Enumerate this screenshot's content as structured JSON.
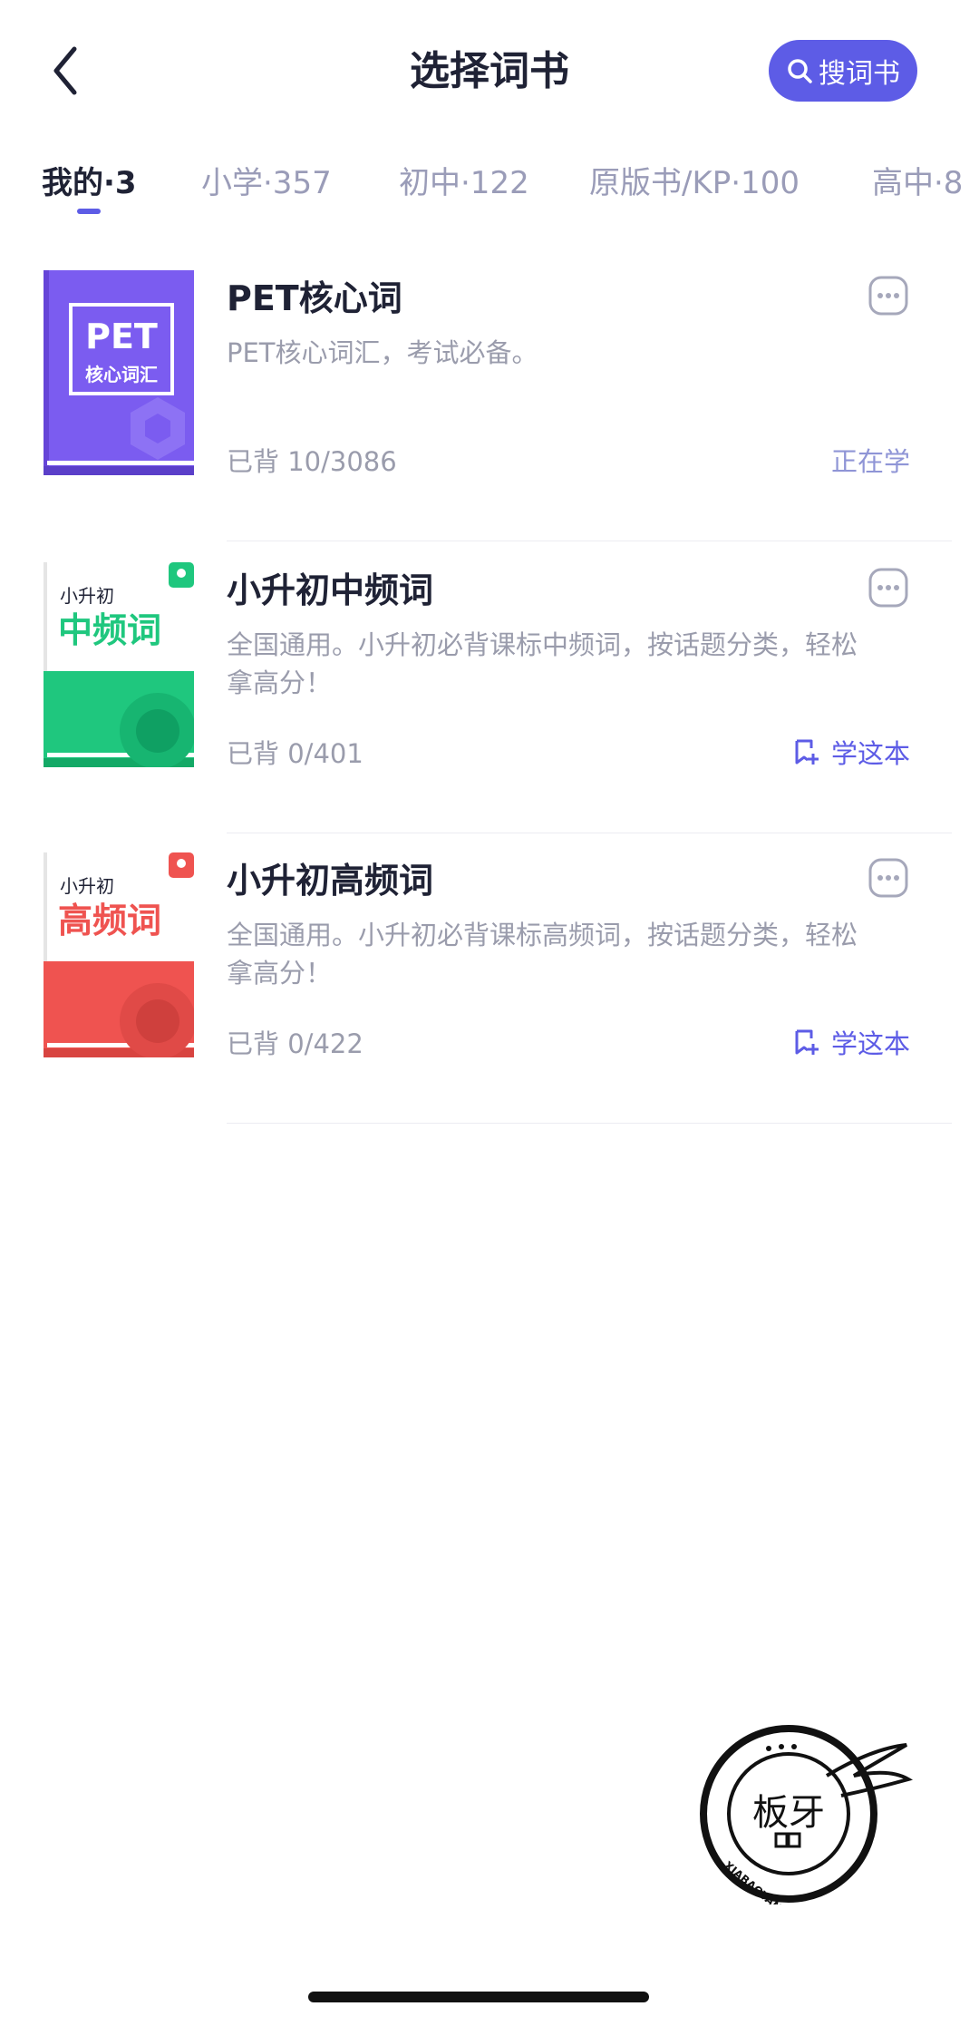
{
  "header": {
    "title": "选择词书",
    "search_label": "搜词书"
  },
  "tabs": [
    {
      "label": "我的·3",
      "active": true
    },
    {
      "label": "小学·357"
    },
    {
      "label": "初中·122"
    },
    {
      "label": "原版书/KP·100"
    },
    {
      "label": "高中·8"
    }
  ],
  "books": [
    {
      "title": "PET核心词",
      "description": "PET核心词汇，考试必备。",
      "progress": "已背 10/3086",
      "status": "正在学",
      "cover": {
        "text_line1": "PET",
        "text_line2": "核心词汇",
        "color": "#7b5cf0"
      }
    },
    {
      "title": "小升初中频词",
      "description": "全国通用。小升初必背课标中频词，按话题分类，轻松拿高分！",
      "progress": "已背 0/401",
      "action_label": "学这本",
      "cover": {
        "small": "小升初",
        "big": "中频词",
        "color": "#1fc77e"
      }
    },
    {
      "title": "小升初高频词",
      "description": "全国通用。小升初必背课标高频词，按话题分类，轻松拿高分！",
      "progress": "已背 0/422",
      "action_label": "学这本",
      "cover": {
        "small": "小升初",
        "big": "高频词",
        "color": "#ef5350"
      }
    }
  ],
  "watermark": {
    "text": "板牙",
    "ring_text": "XIABAOYAN"
  },
  "colors": {
    "accent": "#5d5ce6",
    "text": "#1f2235",
    "muted": "#9a9cac"
  }
}
